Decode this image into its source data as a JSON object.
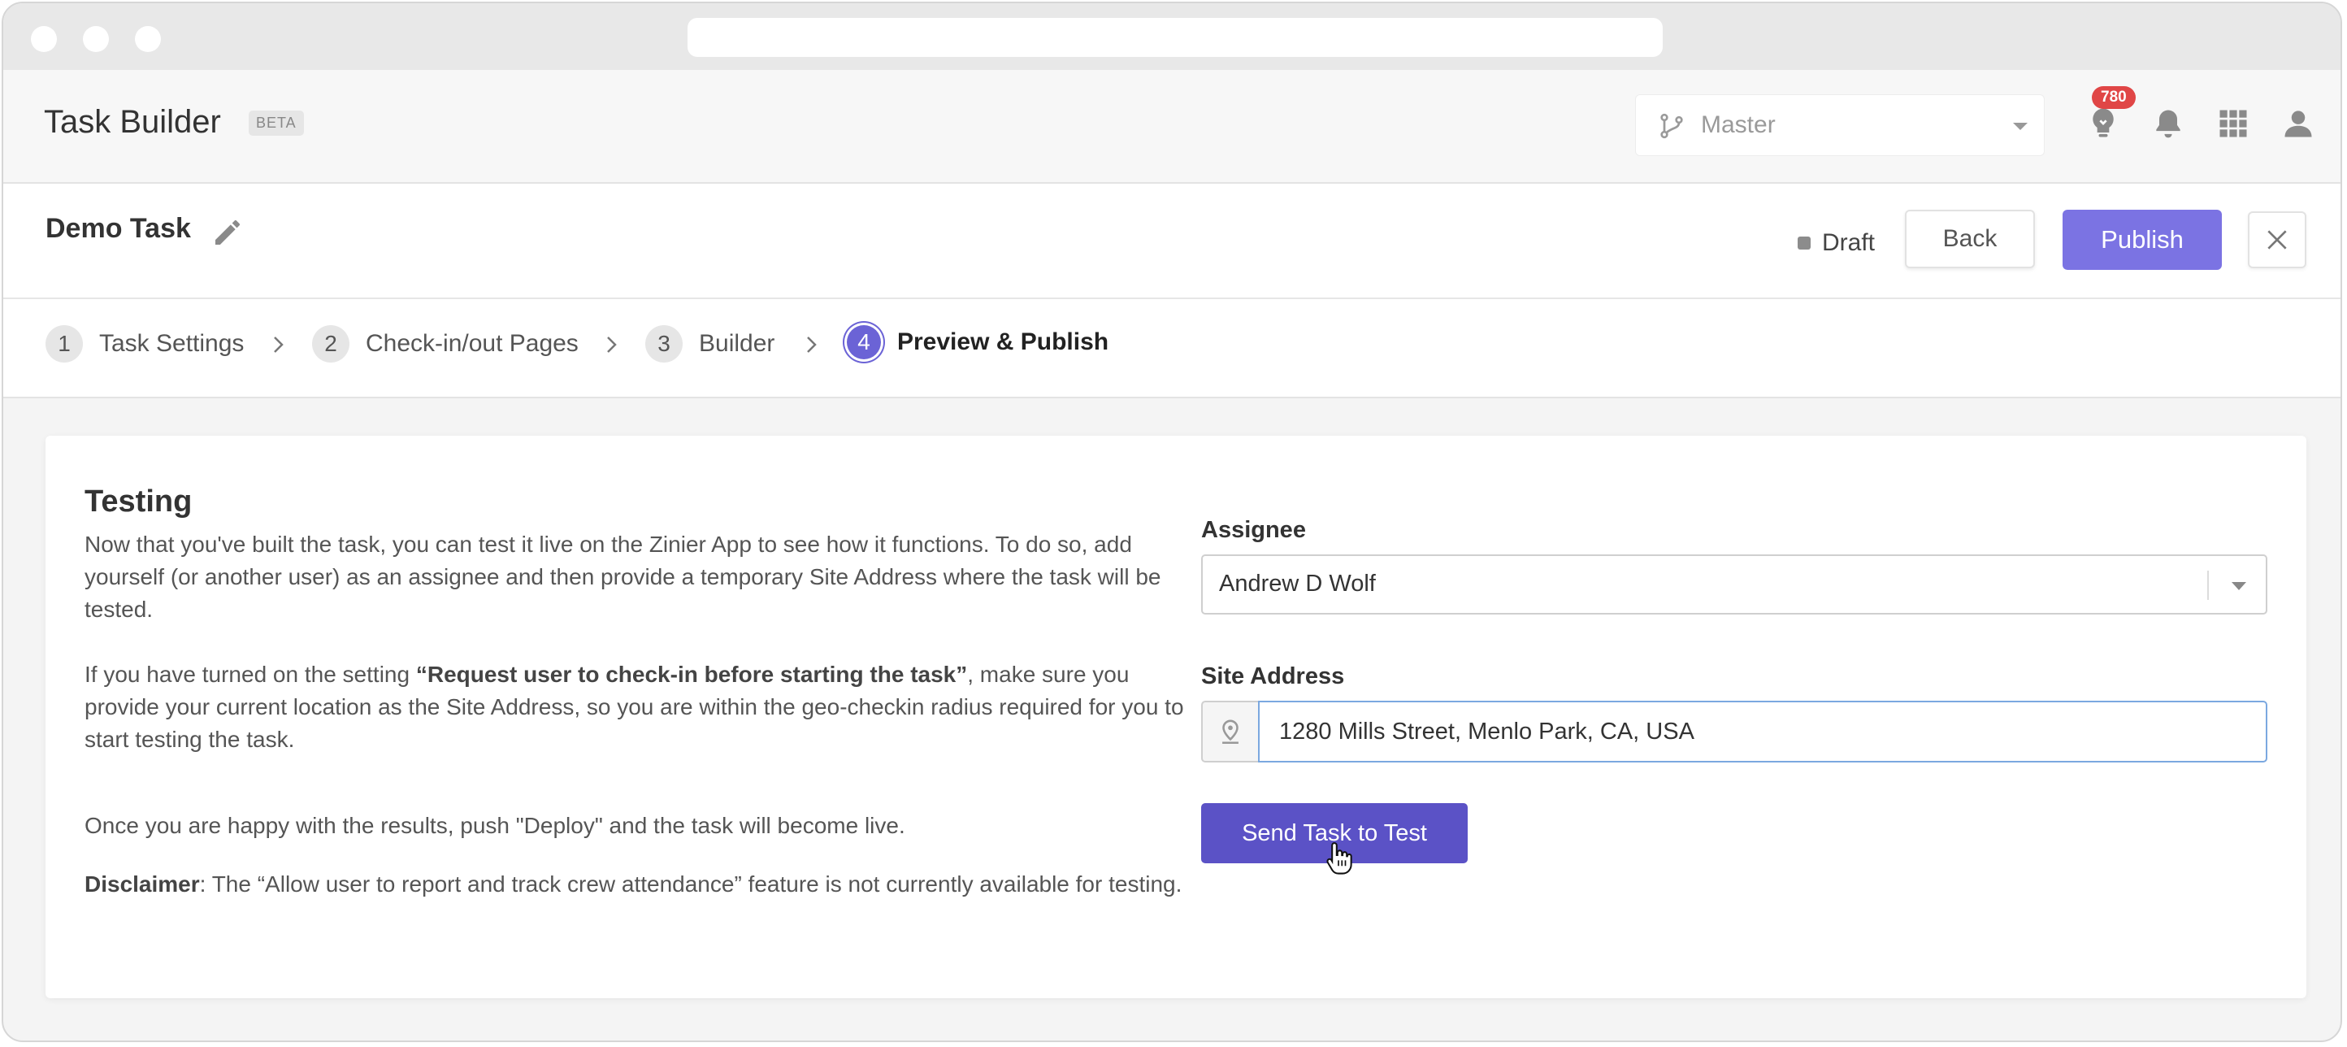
{
  "app": {
    "title": "Task Builder",
    "beta_badge": "BETA",
    "branch_label": "Master",
    "hint_count": "780"
  },
  "task": {
    "name": "Demo Task",
    "status": "Draft",
    "back_label": "Back",
    "publish_label": "Publish"
  },
  "steps": [
    {
      "num": "1",
      "label": "Task Settings"
    },
    {
      "num": "2",
      "label": "Check-in/out Pages"
    },
    {
      "num": "3",
      "label": "Builder"
    },
    {
      "num": "4",
      "label": "Preview & Publish"
    }
  ],
  "testing": {
    "title": "Testing",
    "intro": "Now that you've built the task, you can test it live on the Zinier App to see how it functions. To do so, add yourself (or another user) as an assignee and then provide a temporary Site Address where the task will be tested.",
    "setting_pre": "If you have turned on the setting ",
    "setting_name": "“Request user to check-in before starting the task”",
    "setting_post": ", make sure you provide your current location as the Site Address, so you are within the geo-checkin radius required for you to start testing the task.",
    "deploy_note": "Once you are happy with the results, push \"Deploy\" and the task will become live.",
    "disclaimer_label": "Disclaimer",
    "disclaimer_text": ": The “Allow user to report and track crew attendance” feature is not currently available for testing.",
    "assignee_label": "Assignee",
    "assignee_value": "Andrew D Wolf",
    "site_label": "Site Address",
    "site_value": "1280 Mills Street, Menlo Park, CA, USA",
    "send_label": "Send Task to Test"
  },
  "colors": {
    "accent": "#7b73e3",
    "accent_dark": "#5b52c6",
    "badge": "#e04646"
  }
}
